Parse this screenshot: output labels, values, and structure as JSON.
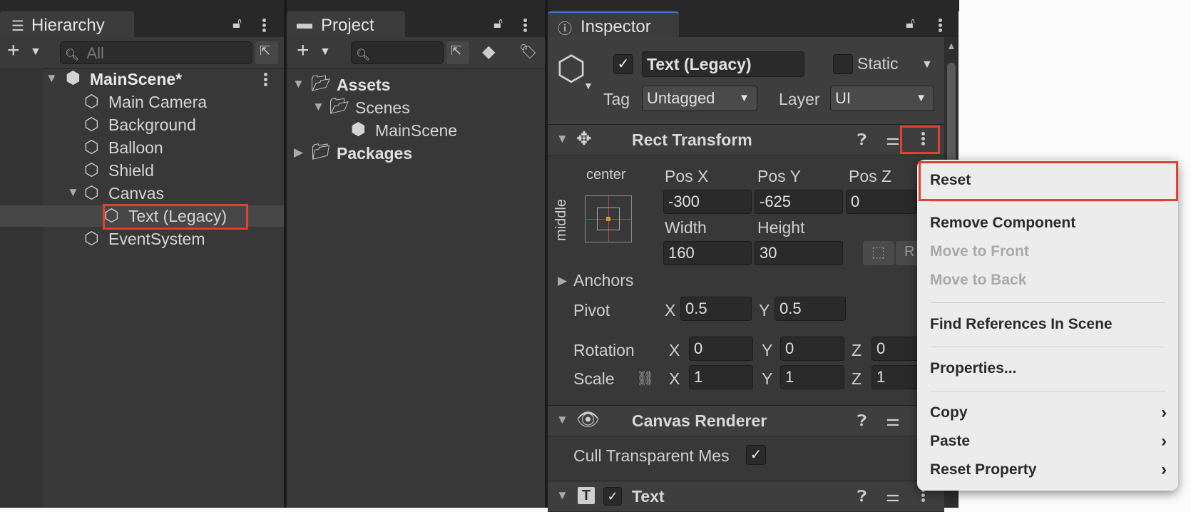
{
  "hierarchy": {
    "tab_label": "Hierarchy",
    "search_placeholder": "All",
    "scene": "MainScene*",
    "items": [
      {
        "label": "Main Camera"
      },
      {
        "label": "Background"
      },
      {
        "label": "Balloon"
      },
      {
        "label": "Shield"
      },
      {
        "label": "Canvas"
      },
      {
        "label": "Text (Legacy)",
        "selected": true
      },
      {
        "label": "EventSystem"
      }
    ]
  },
  "project": {
    "tab_label": "Project",
    "tree": {
      "assets": "Assets",
      "scenes": "Scenes",
      "mainscene": "MainScene",
      "packages": "Packages"
    }
  },
  "inspector": {
    "tab_label": "Inspector",
    "object_name": "Text (Legacy)",
    "static_label": "Static",
    "tag_label": "Tag",
    "tag_value": "Untagged",
    "layer_label": "Layer",
    "layer_value": "UI",
    "rect_transform": {
      "title": "Rect Transform",
      "anchor_h": "center",
      "anchor_v": "middle",
      "posx_label": "Pos X",
      "posx": "-300",
      "posy_label": "Pos Y",
      "posy": "-625",
      "posz_label": "Pos Z",
      "posz": "0",
      "width_label": "Width",
      "width": "160",
      "height_label": "Height",
      "height": "30",
      "anchors_label": "Anchors",
      "pivot_label": "Pivot",
      "pivot_x": "0.5",
      "pivot_y": "0.5",
      "rotation_label": "Rotation",
      "rot_x": "0",
      "rot_y": "0",
      "rot_z": "0",
      "scale_label": "Scale",
      "scale_x": "1",
      "scale_y": "1",
      "scale_z": "1",
      "x": "X",
      "y": "Y",
      "z": "Z",
      "r_letter": "R"
    },
    "canvas_renderer": {
      "title": "Canvas Renderer",
      "cull_label": "Cull Transparent Mes"
    },
    "text_component": {
      "title": "Text"
    }
  },
  "context_menu": {
    "items": {
      "reset": "Reset",
      "remove": "Remove Component",
      "front": "Move to Front",
      "back": "Move to Back",
      "find": "Find References In Scene",
      "properties": "Properties...",
      "copy": "Copy",
      "paste": "Paste",
      "reset_property": "Reset Property"
    }
  },
  "colors": {
    "highlight": "#e2412d",
    "panel": "#383838",
    "menu": "#ececec"
  }
}
